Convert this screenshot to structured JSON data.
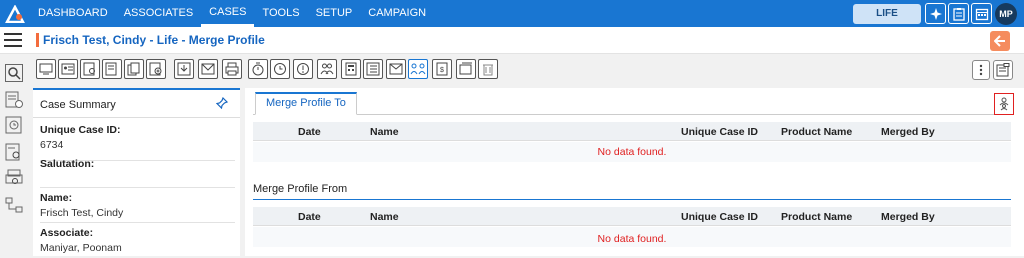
{
  "nav": {
    "items": [
      "DASHBOARD",
      "ASSOCIATES",
      "CASES",
      "TOOLS",
      "SETUP",
      "CAMPAIGN"
    ],
    "active": "CASES",
    "product_badge": "LIFE",
    "avatar_initials": "MP"
  },
  "page": {
    "title": "Frisch Test, Cindy - Life - Merge Profile"
  },
  "summary": {
    "title": "Case Summary",
    "fields": [
      {
        "label": "Unique Case ID:",
        "value": "6734"
      },
      {
        "label": "Salutation:",
        "value": ""
      },
      {
        "label": "Name:",
        "value": "Frisch Test, Cindy"
      },
      {
        "label": "Associate:",
        "value": "Maniyar, Poonam"
      }
    ]
  },
  "merge": {
    "tab_label": "Merge Profile To",
    "section_from_label": "Merge Profile From",
    "columns": [
      "Date",
      "Name",
      "Unique Case ID",
      "Product Name",
      "Merged By"
    ],
    "no_data": "No data found."
  },
  "colors": {
    "nav_bg": "#1976d2",
    "accent_orange": "#f36c3d",
    "error_red": "#e02020"
  }
}
